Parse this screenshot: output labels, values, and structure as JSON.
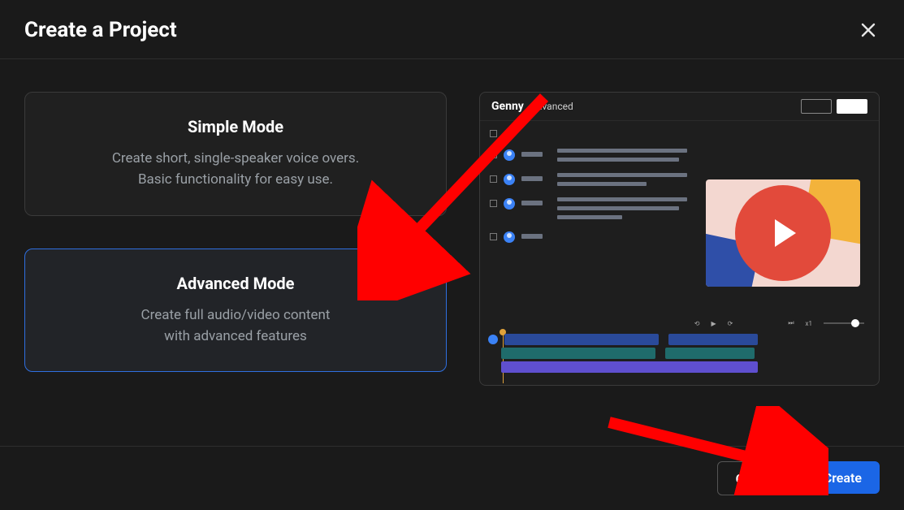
{
  "header": {
    "title": "Create a Project"
  },
  "modes": {
    "simple": {
      "title": "Simple Mode",
      "desc_line1": "Create short, single-speaker voice overs.",
      "desc_line2": "Basic functionality for easy use."
    },
    "advanced": {
      "title": "Advanced Mode",
      "desc_line1": "Create full audio/video content",
      "desc_line2": "with advanced features",
      "selected": true
    }
  },
  "preview": {
    "brand": "Genny",
    "mode_label": "Advanced",
    "timeline_speed": "x1"
  },
  "footer": {
    "cancel": "Cancel",
    "create": "Create"
  },
  "colors": {
    "accent": "#1b66e6",
    "arrow": "#ff0000"
  }
}
